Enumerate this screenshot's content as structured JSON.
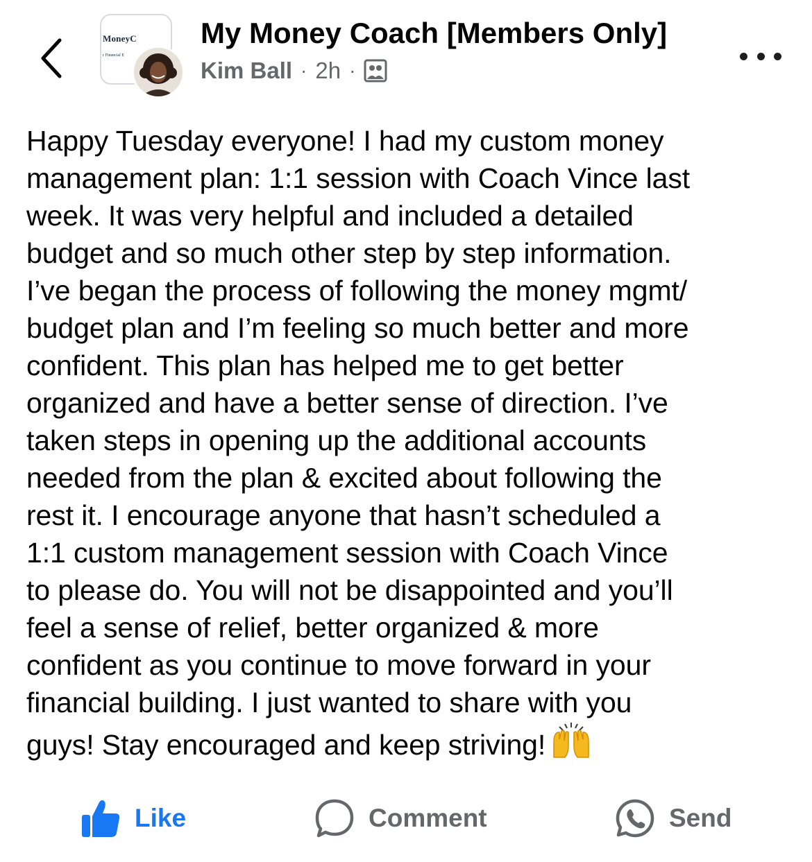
{
  "header": {
    "group_name": "My Money Coach [Members Only]",
    "author": "Kim Ball",
    "separator": "·",
    "time": "2h",
    "group_thumb_title": "MoneyC",
    "group_thumb_subtitle": "r Financial E"
  },
  "post": {
    "text": "Happy Tuesday everyone! I had my custom money\nmanagement plan: 1:1 session with Coach Vince last\nweek. It was very helpful and included a detailed\nbudget and so much other step by step information.\nI’ve began the process of following the money mgmt/\nbudget plan and I’m feeling so much better and more\nconfident. This plan has helped me to get better\norganized and have a better sense of direction. I’ve\ntaken steps in opening up the additional accounts\nneeded from the plan & excited about following the\nrest it. I encourage anyone that hasn’t scheduled a\n1:1 custom management session with Coach Vince\nto please do. You will not be disappointed and you’ll\nfeel a sense of relief, better organized & more\nconfident as you continue to move forward in your\nfinancial building. I just wanted to share with you\nguys! Stay encouraged and keep striving!",
    "emoji": "raising-hands"
  },
  "actions": {
    "like_label": "Like",
    "comment_label": "Comment",
    "send_label": "Send"
  },
  "colors": {
    "like_blue": "#1877f2",
    "secondary_text": "#65676b",
    "primary_text": "#050505"
  }
}
